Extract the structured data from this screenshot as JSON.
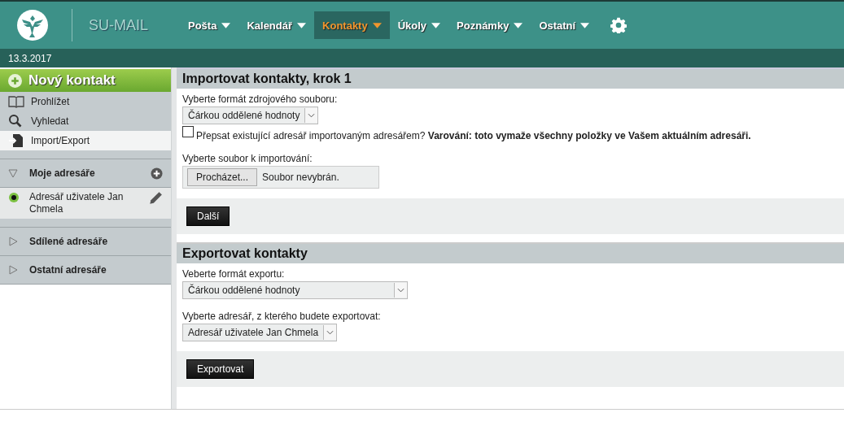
{
  "header": {
    "app_name": "SU-MAIL",
    "date": "13.3.2017",
    "nav": [
      {
        "label": "Pošta",
        "selected": false
      },
      {
        "label": "Kalendář",
        "selected": false
      },
      {
        "label": "Kontakty",
        "selected": true
      },
      {
        "label": "Úkoly",
        "selected": false
      },
      {
        "label": "Poznámky",
        "selected": false
      },
      {
        "label": "Ostatní",
        "selected": false
      }
    ]
  },
  "sidebar": {
    "new_contact": "Nový kontakt",
    "items": [
      {
        "label": "Prohlížet",
        "kind": "book",
        "selected": false
      },
      {
        "label": "Vyhledat",
        "kind": "search",
        "selected": false
      },
      {
        "label": "Import/Export",
        "kind": "import",
        "selected": true
      }
    ],
    "groups": [
      {
        "label": "Moje adresáře",
        "expanded": true,
        "children": [
          {
            "label": "Adresář uživatele Jan Chmela",
            "selected": true
          }
        ]
      },
      {
        "label": "Sdílené adresáře",
        "expanded": false
      },
      {
        "label": "Ostatní adresáře",
        "expanded": false
      }
    ]
  },
  "import": {
    "title": "Importovat kontakty, krok 1",
    "format_label": "Vyberte formát zdrojového souboru:",
    "format_value": "Čárkou oddělené hodnoty",
    "overwrite": {
      "checked": false,
      "text": "Přepsat existující adresář importovaným adresářem? **Varování: toto vymaže všechny položky ve Vašem aktuálním adresáři.**"
    },
    "file_label": "Vyberte soubor k importování:",
    "browse_button": "Procházet...",
    "file_status": "Soubor nevybrán.",
    "next_button": "Další"
  },
  "export": {
    "title": "Exportovat kontakty",
    "format_label": "Veberte formát exportu:",
    "format_value": "Čárkou oddělené hodnoty",
    "addressbook_label": "Vyberte adresář, z kterého budete exportovat:",
    "addressbook_value": "Adresář uživatele Jan Chmela",
    "export_button": "Exportovat"
  }
}
